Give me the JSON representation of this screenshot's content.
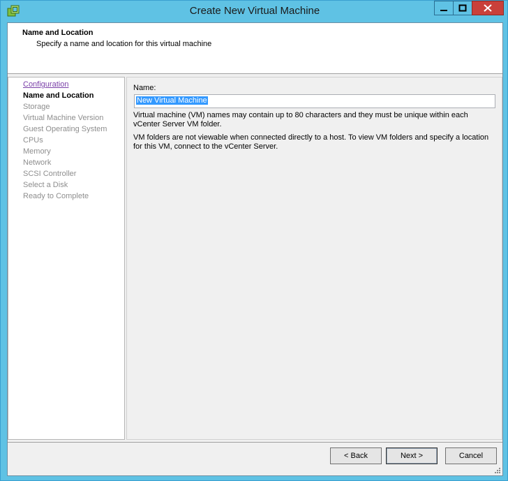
{
  "window": {
    "title": "Create New Virtual Machine",
    "app_icon": "vm-icon",
    "controls": {
      "minimize": "minimize-icon",
      "maximize": "maximize-icon",
      "close": "close-icon"
    },
    "accent": "#5fc2e4"
  },
  "header": {
    "title": "Name and Location",
    "subtitle": "Specify a name and location for this virtual machine"
  },
  "nav": {
    "items": [
      {
        "label": "Configuration",
        "state": "link"
      },
      {
        "label": "Name and Location",
        "state": "current"
      },
      {
        "label": "Storage",
        "state": "disabled"
      },
      {
        "label": "Virtual Machine Version",
        "state": "disabled"
      },
      {
        "label": "Guest Operating System",
        "state": "disabled"
      },
      {
        "label": "CPUs",
        "state": "disabled"
      },
      {
        "label": "Memory",
        "state": "disabled"
      },
      {
        "label": "Network",
        "state": "disabled"
      },
      {
        "label": "SCSI Controller",
        "state": "disabled"
      },
      {
        "label": "Select a Disk",
        "state": "disabled"
      },
      {
        "label": "Ready to Complete",
        "state": "disabled"
      }
    ]
  },
  "main": {
    "name_label": "Name:",
    "name_value": "New Virtual Machine",
    "info1_line1": "Virtual machine (VM) names may contain up to 80 characters and they must be unique within each",
    "info1_line2": "vCenter Server VM folder.",
    "info2_line1": "VM folders are not viewable when connected directly to a host. To view VM folders and specify a location",
    "info2_line2": "for this VM, connect to the vCenter Server."
  },
  "buttons": {
    "back": "< Back",
    "next": "Next >",
    "cancel": "Cancel"
  }
}
